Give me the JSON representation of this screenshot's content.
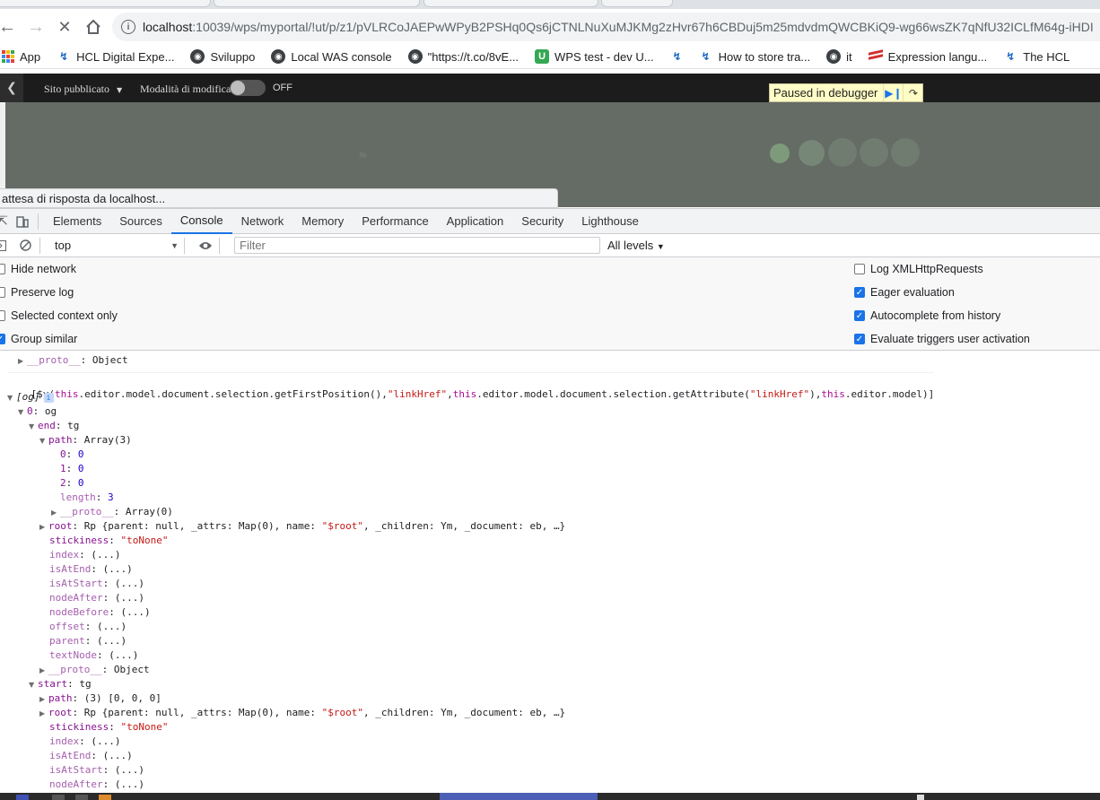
{
  "browser": {
    "url_host": "localhost",
    "url_path": ":10039/wps/myportal/!ut/p/z1/pVLRCoJAEPwWPyB2PSHq0Qs6jCTNLNuXuMJKMg2zHvr67h6CBDuj5m25mdvdmQWCBKiQ9-wg66wsZK7qNfU32ICLfM64g-iHDI",
    "bookmarks": [
      {
        "label": "App",
        "icon": "apps-grid-icon"
      },
      {
        "label": "HCL Digital Expe...",
        "icon": "hcl-icon"
      },
      {
        "label": "Sviluppo",
        "icon": "globe-icon"
      },
      {
        "label": "Local WAS console",
        "icon": "globe-icon"
      },
      {
        "label": "\"https://t.co/8vE...",
        "icon": "globe-icon"
      },
      {
        "label": "WPS test - dev U...",
        "icon": "u-icon"
      },
      {
        "label": "",
        "icon": "hcl-icon"
      },
      {
        "label": "How to store tra...",
        "icon": "hcl-icon"
      },
      {
        "label": "it",
        "icon": "globe-icon"
      },
      {
        "label": "Expression langu...",
        "icon": "stripes-icon"
      },
      {
        "label": "The HCL",
        "icon": "hcl-icon"
      }
    ]
  },
  "portal": {
    "site_label": "Sito pubblicato",
    "edit_mode_label": "Modalità di modifica:",
    "toggle_state": "OFF"
  },
  "debugger": {
    "paused_label": "Paused in debugger"
  },
  "status_text": "attesa di risposta da localhost...",
  "devtools": {
    "tabs": [
      "Elements",
      "Sources",
      "Console",
      "Network",
      "Memory",
      "Performance",
      "Application",
      "Security",
      "Lighthouse"
    ],
    "active_tab": "Console",
    "context": "top",
    "filter_placeholder": "Filter",
    "levels": "All levels",
    "settings_left": [
      {
        "label": "Hide network",
        "checked": false
      },
      {
        "label": "Preserve log",
        "checked": false
      },
      {
        "label": "Selected context only",
        "checked": false
      },
      {
        "label": "Group similar",
        "checked": true
      }
    ],
    "settings_right": [
      {
        "label": "Log XMLHttpRequests",
        "checked": false
      },
      {
        "label": "Eager evaluation",
        "checked": true
      },
      {
        "label": "Autocomplete from history",
        "checked": true
      },
      {
        "label": "Evaluate triggers user activation",
        "checked": true
      }
    ]
  },
  "console": {
    "proto_top": "Object",
    "command": "[$y(this.editor.model.document.selection.getFirstPosition(),\"linkHref\",this.editor.model.document.selection.getAttribute(\"linkHref\"),this.editor.model)]",
    "result_label": "[og]",
    "item0": "og",
    "end_type": "tg",
    "path_type": "Array(3)",
    "path_values": [
      "0",
      "0",
      "0"
    ],
    "path_length": "3",
    "array_proto": "Array(0)",
    "root_preview": "Rp {parent: null, _attrs: Map(0), name: \"$root\", _children: Ym, _document: eb, …}",
    "stickiness": "\"toNone\"",
    "getters": [
      "index",
      "isAtEnd",
      "isAtStart",
      "nodeAfter",
      "nodeBefore",
      "offset",
      "parent",
      "textNode"
    ],
    "getter_value": "(...)",
    "obj_proto": "Object",
    "start_type": "tg",
    "start_path": "(3) [0, 0, 0]",
    "start_getters": [
      "index",
      "isAtEnd",
      "isAtStart",
      "nodeAfter"
    ]
  }
}
